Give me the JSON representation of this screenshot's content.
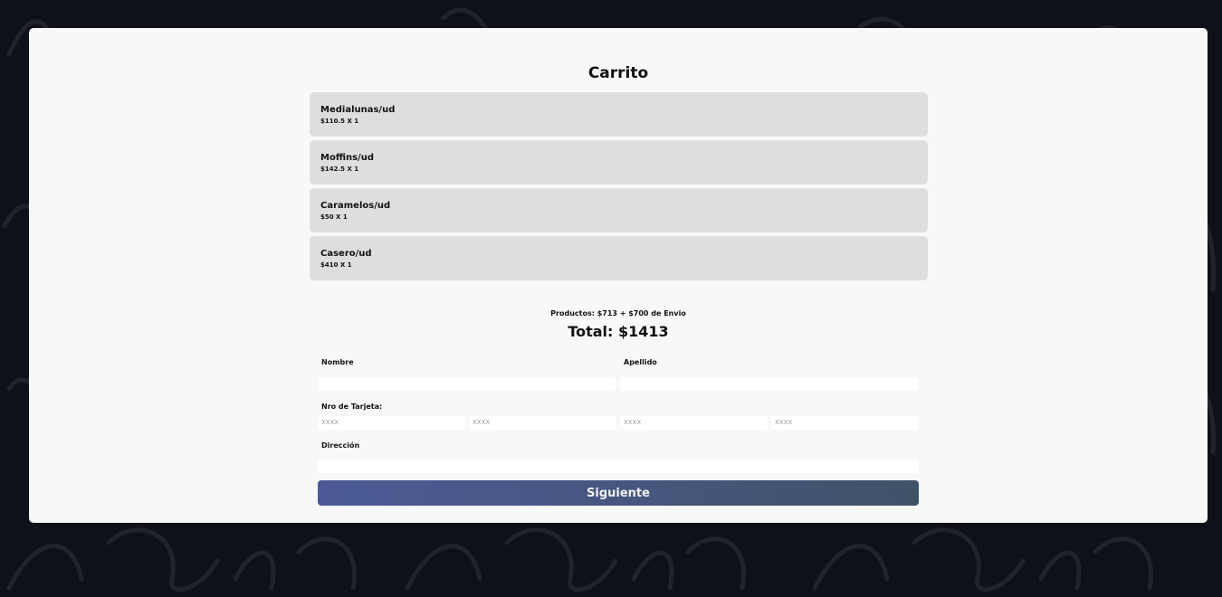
{
  "cart": {
    "title": "Carrito",
    "items": [
      {
        "name": "Medialunas/ud",
        "price": "$110.5 X 1"
      },
      {
        "name": "Moffins/ud",
        "price": "$142.5 X 1"
      },
      {
        "name": "Caramelos/ud",
        "price": "$50 X 1"
      },
      {
        "name": "Casero/ud",
        "price": "$410 X 1"
      }
    ],
    "summary": "Productos: $713 + $700 de Envio",
    "total": "Total: $1413"
  },
  "form": {
    "nombre_label": "Nombre",
    "nombre_value": "",
    "apellido_label": "Apellido",
    "apellido_value": "",
    "tarjeta_label": "Nro de Tarjeta:",
    "tarjeta_placeholder": "XXXX",
    "direccion_label": "Dirección",
    "direccion_value": "",
    "submit_label": "Siguiente"
  },
  "colors": {
    "background": "#0e1117",
    "card": "#f8f8f8",
    "item": "#dedede",
    "button_start": "#4b5a96",
    "button_end": "#3f5368"
  }
}
